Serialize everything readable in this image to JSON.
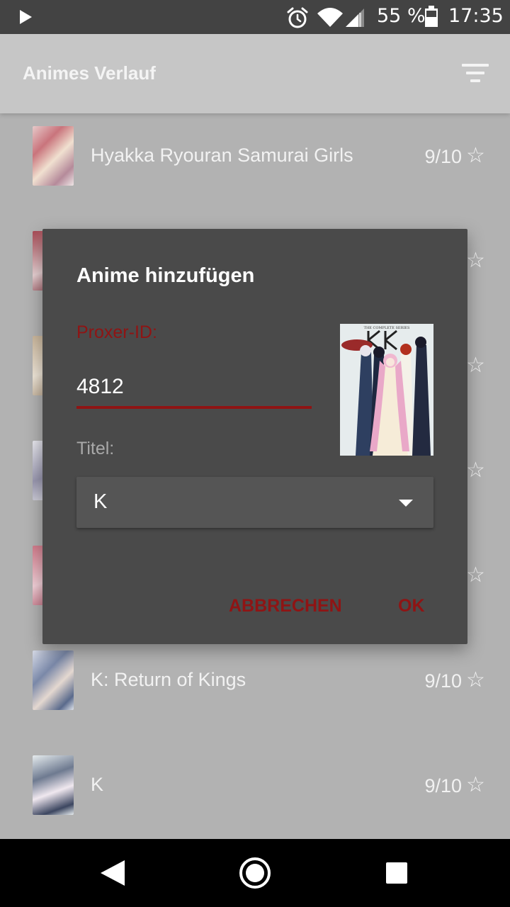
{
  "status_bar": {
    "battery_percent": "55 %",
    "battery_level": 0.55,
    "time": "17:35",
    "icons": [
      "play-icon",
      "alarm-icon",
      "wifi-icon",
      "signal-icon",
      "battery-icon"
    ]
  },
  "app_bar": {
    "title": "Animes Verlauf",
    "filter_icon": "filter-list-icon"
  },
  "list": {
    "items": [
      {
        "title": "Hyakka Ryouran Samurai Girls",
        "rating": "9/10",
        "star_icon": "star-outline-icon"
      },
      {
        "title": "",
        "rating": "",
        "star_icon": "star-outline-icon"
      },
      {
        "title": "",
        "rating": "",
        "star_icon": "star-outline-icon"
      },
      {
        "title": "",
        "rating": "",
        "star_icon": "star-outline-icon"
      },
      {
        "title": "",
        "rating": "",
        "star_icon": "star-outline-icon"
      },
      {
        "title": "K: Return of Kings",
        "rating": "9/10",
        "star_icon": "star-outline-icon"
      },
      {
        "title": "K",
        "rating": "9/10",
        "star_icon": "star-outline-icon"
      }
    ]
  },
  "dialog": {
    "title": "Anime hinzufügen",
    "id_label": "Proxer-ID:",
    "id_value": "4812",
    "title_label": "Titel:",
    "title_selected": "K",
    "cancel_label": "ABBRECHEN",
    "ok_label": "OK"
  },
  "nav_bar": {
    "icons": [
      "back-icon",
      "home-icon",
      "recents-icon"
    ]
  },
  "colors": {
    "accent": "#8f1414",
    "dialog_bg": "#4a4a4a",
    "app_bar_bg": "#c6c6c6",
    "status_bar_bg": "#434343"
  }
}
